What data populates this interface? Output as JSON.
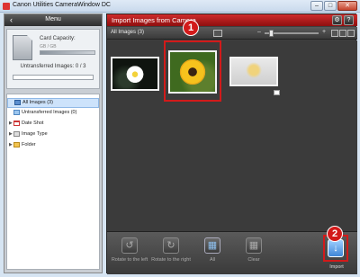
{
  "window": {
    "title": "Canon Utilities CameraWindow DC",
    "minimize": "–",
    "maximize": "□",
    "close": "✕"
  },
  "left_panel": {
    "back_icon": "‹",
    "menu_label": "Menu",
    "card_capacity_label": "Card Capacity:",
    "card_capacity_value": "GB / GB",
    "untransferred_label": "Untransferred Images: 0 / 3",
    "tree": [
      {
        "label": "All Images (3)",
        "icon": "images-icon",
        "selected": true
      },
      {
        "label": "Untransferred Images (0)",
        "icon": "untransferred-icon",
        "selected": false
      },
      {
        "label": "Date Shot",
        "icon": "calendar-icon",
        "selected": false
      },
      {
        "label": "Image Type",
        "icon": "image-type-icon",
        "selected": false
      },
      {
        "label": "Folder",
        "icon": "folder-icon",
        "selected": false
      }
    ]
  },
  "main": {
    "header_title": "Import Images from Camera",
    "settings_icon": "⚙",
    "help_icon": "?",
    "toolbar_label": "All Images (3)",
    "zoom_minus": "–",
    "zoom_plus": "+",
    "zoom_level": 0.1,
    "thumbnails": [
      {
        "name": "daisy-photo",
        "selected": false
      },
      {
        "name": "sunflower-photo",
        "selected": true
      },
      {
        "name": "chick-photo",
        "selected": false
      }
    ],
    "callout_1": "1",
    "callout_2": "2",
    "bottom_bar": {
      "rotate_left": "Rotate to the left",
      "rotate_right": "Rotate to the right",
      "all": "All",
      "clear": "Clear",
      "import": "Import"
    }
  }
}
